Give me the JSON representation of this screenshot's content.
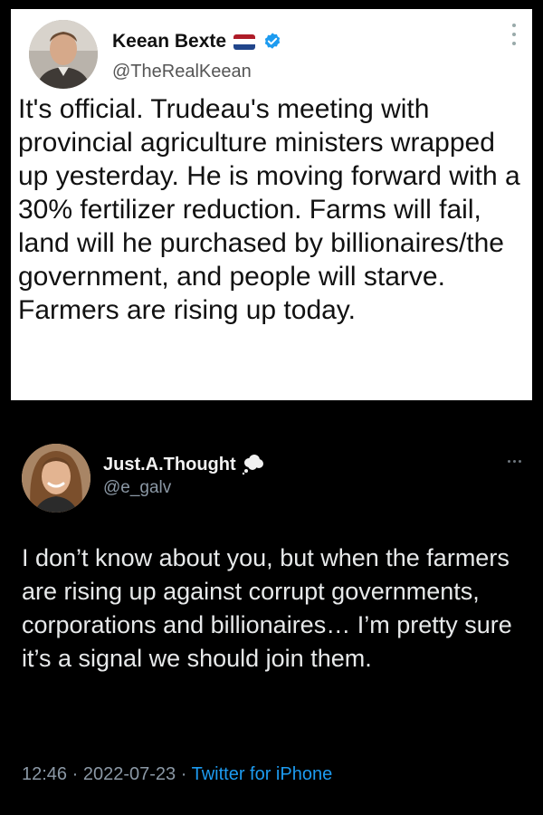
{
  "tweet_top": {
    "display_name": "Keean Bexte",
    "handle": "@TheRealKeean",
    "text": "It's official. Trudeau's meeting with provincial agriculture ministers wrapped up yesterday. He is moving forward with a 30% fertilizer reduction. Farms will fail, land will he purchased by billionaires/the government, and people will starve. Farmers are rising up today.",
    "flag_icon": "netherlands-flag-icon",
    "badge_icon": "verified-badge-icon",
    "colors": {
      "background": "#ffffff",
      "text": "#111111",
      "handle": "#555555",
      "verified": "#1d9bf0"
    }
  },
  "tweet_bottom": {
    "display_name": "Just.A.Thought",
    "handle": "@e_galv",
    "text": "I don’t know about you, but when the farmers are rising up against corrupt governments, corporations and billionaires… I’m pretty sure it’s a signal we should join them.",
    "badge_icon": "thought-cloud-icon",
    "time": "12:46",
    "separator": " · ",
    "date": "2022-07-23",
    "source": "Twitter for iPhone",
    "colors": {
      "background": "#000000",
      "text": "#e7e9ea",
      "meta": "#8b98a5",
      "link": "#1d9bf0"
    }
  }
}
